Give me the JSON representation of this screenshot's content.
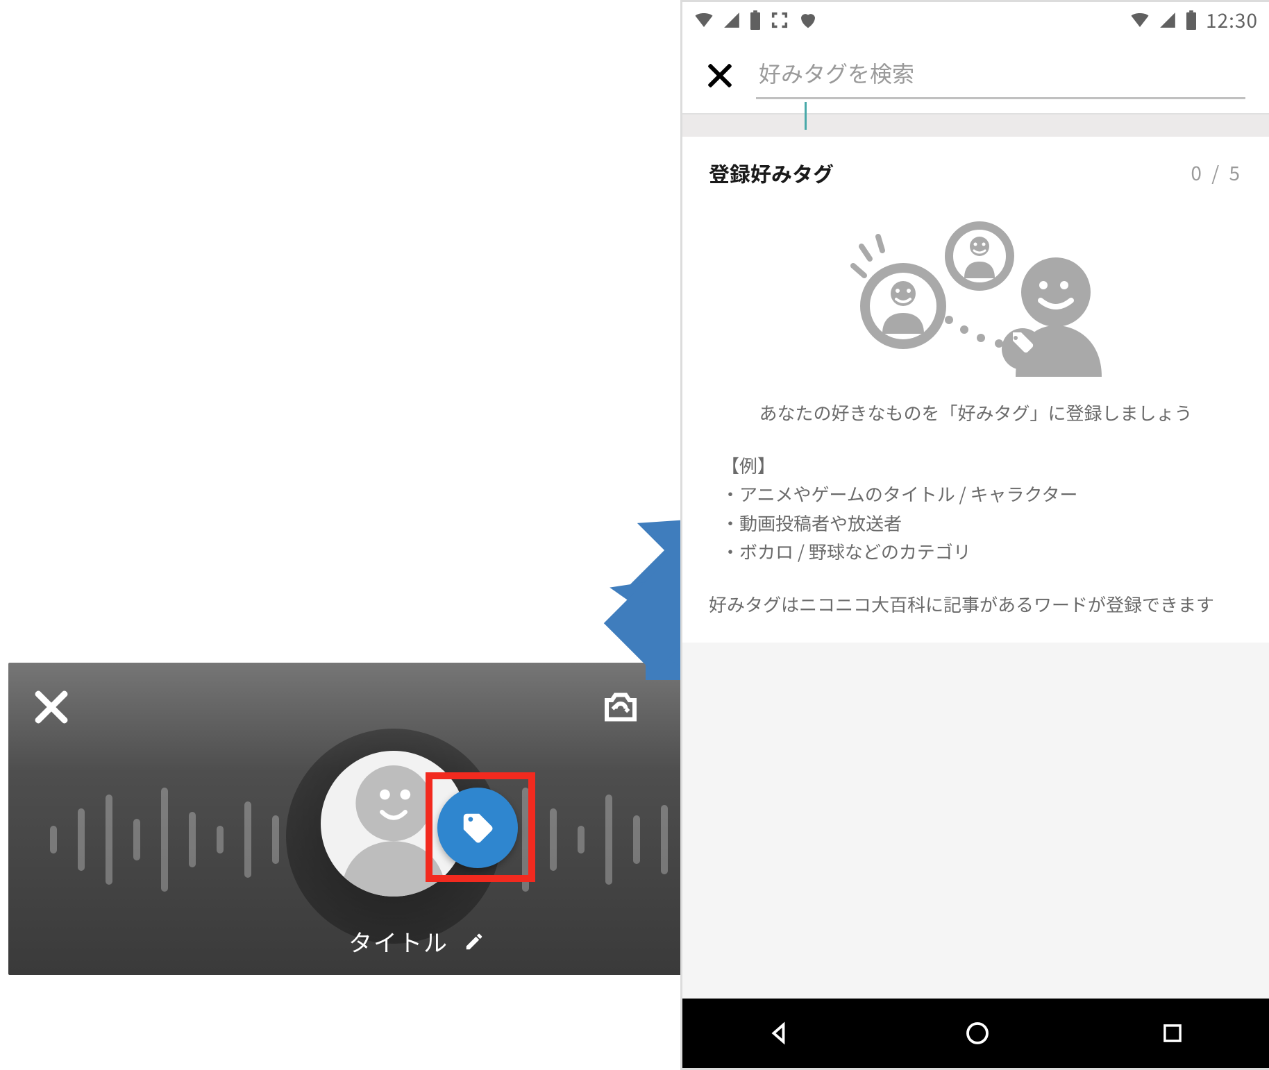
{
  "phone": {
    "status": {
      "time": "12:30"
    },
    "search": {
      "placeholder": "好みタグを検索"
    },
    "section": {
      "title": "登録好みタグ",
      "count": "0 / 5",
      "lead": "あなたの好きなものを「好みタグ」に登録しましょう",
      "examples_header": "【例】",
      "examples": [
        "アニメやゲームのタイトル / キャラクター",
        "動画投稿者や放送者",
        "ボカロ / 野球などのカテゴリ"
      ],
      "note": "好みタグはニコニコ大百科に記事があるワードが登録できます"
    }
  },
  "broadcast": {
    "title_label": "タイトル"
  }
}
